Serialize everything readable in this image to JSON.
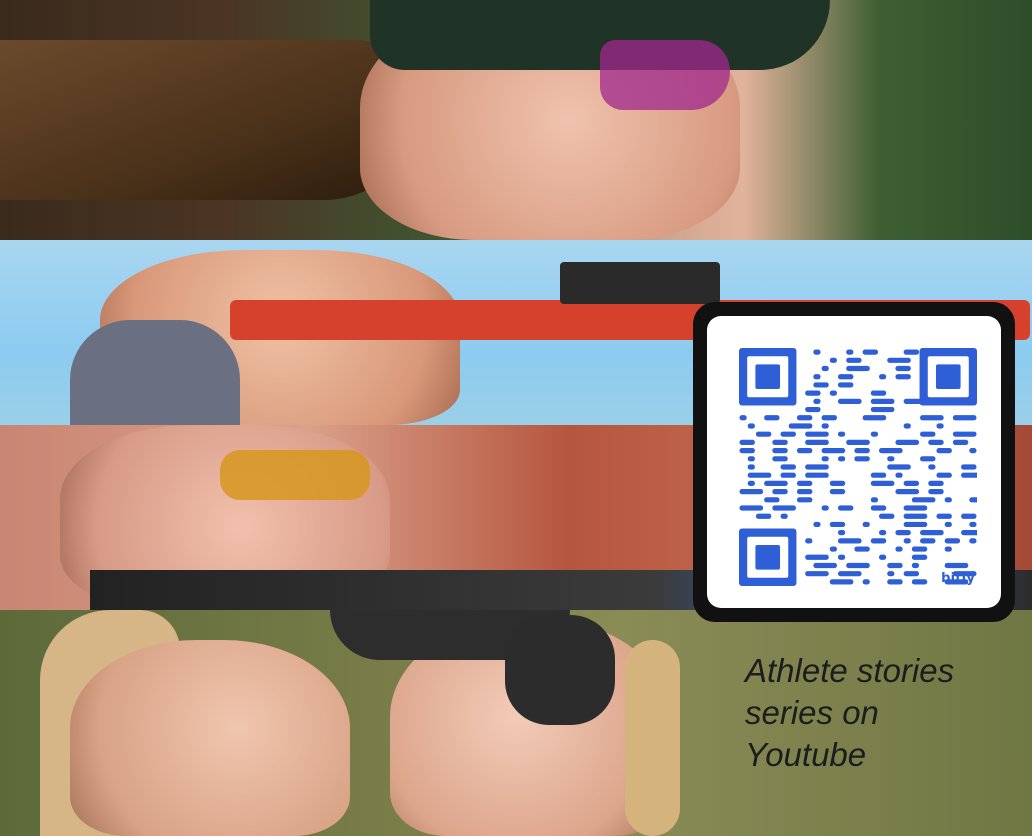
{
  "qr_code": {
    "brand_label": "bitly",
    "color": "#2f5fd6"
  },
  "caption": {
    "lines": [
      "Athlete stories",
      "series on",
      "Youtube"
    ]
  }
}
